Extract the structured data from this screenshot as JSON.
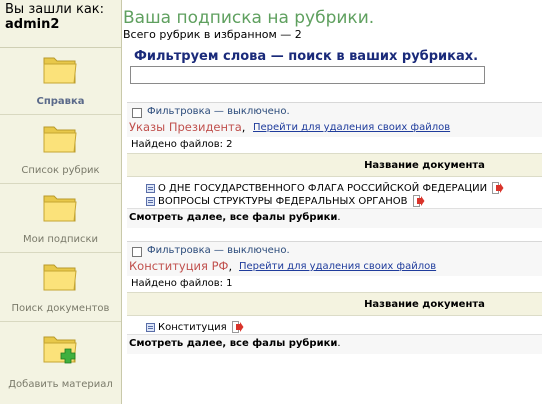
{
  "sidebar": {
    "logged_in_label": "Вы зашли как:",
    "username": "admin2",
    "items": [
      {
        "label": "Справка",
        "icon": "folder-icon",
        "active": true
      },
      {
        "label": "Список рубрик",
        "icon": "folder-icon"
      },
      {
        "label": "Мои подписки",
        "icon": "folder-icon"
      },
      {
        "label": "Поиск документов",
        "icon": "folder-icon"
      },
      {
        "label": "Добавить материал",
        "icon": "folder-add-icon"
      }
    ]
  },
  "main": {
    "title": "Ваша подписка на рубрики.",
    "favorites_count": "Всего рубрик в избранном — 2",
    "filter_heading": "Фильтруем слова — поиск в ваших рубриках.",
    "filter_input_value": ""
  },
  "rubrics": [
    {
      "filter_status": "Фильтровка — выключено.",
      "name": "Указы Президента",
      "separator": ",",
      "delete_link": "Перейти для удаления своих файлов",
      "found": "Найдено файлов: 2",
      "doc_header": "Название документа",
      "docs": [
        "О ДНЕ ГОСУДАРСТВЕННОГО ФЛАГА РОССИЙСКОЙ ФЕДЕРАЦИИ",
        "ВОПРОСЫ СТРУКТУРЫ ФЕДЕРАЛЬНЫХ ОРГАНОВ"
      ],
      "see_more": "Смотреть далее, все фалы рубрики",
      "see_more_end": "."
    },
    {
      "filter_status": "Фильтровка — выключено.",
      "name": "Конституция РФ",
      "separator": ",",
      "delete_link": "Перейти для удаления своих файлов",
      "found": "Найдено файлов: 1",
      "doc_header": "Название документа",
      "docs": [
        "Конституция"
      ],
      "see_more": "Смотреть далее, все фалы рубрики",
      "see_more_end": "."
    }
  ],
  "colors": {
    "title": "#5fa05f",
    "rubric_name": "#c0504d",
    "link": "#1f3c9c",
    "sidebar_bg": "#f3f3e2",
    "header_bg": "#f4f3e0"
  }
}
